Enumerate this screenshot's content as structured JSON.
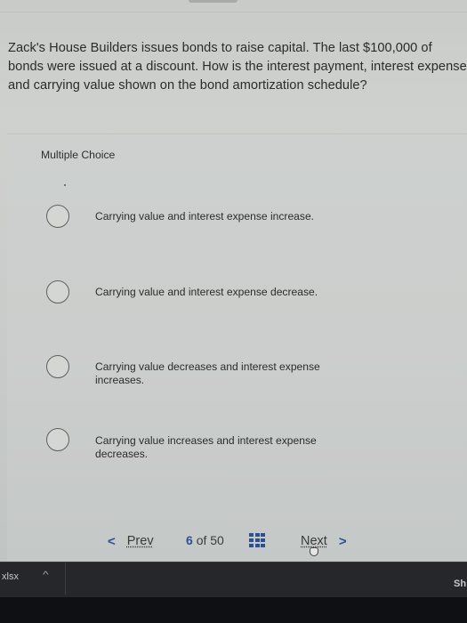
{
  "question": {
    "text": "Zack's House Builders issues bonds to raise capital. The last $100,000 of bonds were issued at a discount.  How is the interest payment, interest expense and carrying value shown on the bond amortization schedule?"
  },
  "quiz": {
    "type_label": "Multiple Choice",
    "options": [
      {
        "label": "Carrying value and interest expense increase.",
        "selected": false
      },
      {
        "label": "Carrying value and interest expense decrease.",
        "selected": false
      },
      {
        "label": "Carrying value decreases and interest expense increases.",
        "selected": false
      },
      {
        "label": "Carrying value increases and interest expense decreases.",
        "selected": false
      }
    ]
  },
  "navigation": {
    "prev_icon": "chevron-left-icon",
    "prev_label": "Prev",
    "current_page": "6",
    "of_label": "of",
    "total_pages": "50",
    "grid_icon": "question-grid-icon",
    "next_label": "Next",
    "next_icon": "chevron-right-icon",
    "prev_chevron": "<",
    "next_chevron": ">"
  },
  "download_bar": {
    "file_name": "xlsx",
    "caret": "^",
    "show_all_label": "Sh"
  },
  "colors": {
    "accent": "#2d4f94",
    "text": "#2a2c2d",
    "download_bar_bg": "#26272b"
  }
}
